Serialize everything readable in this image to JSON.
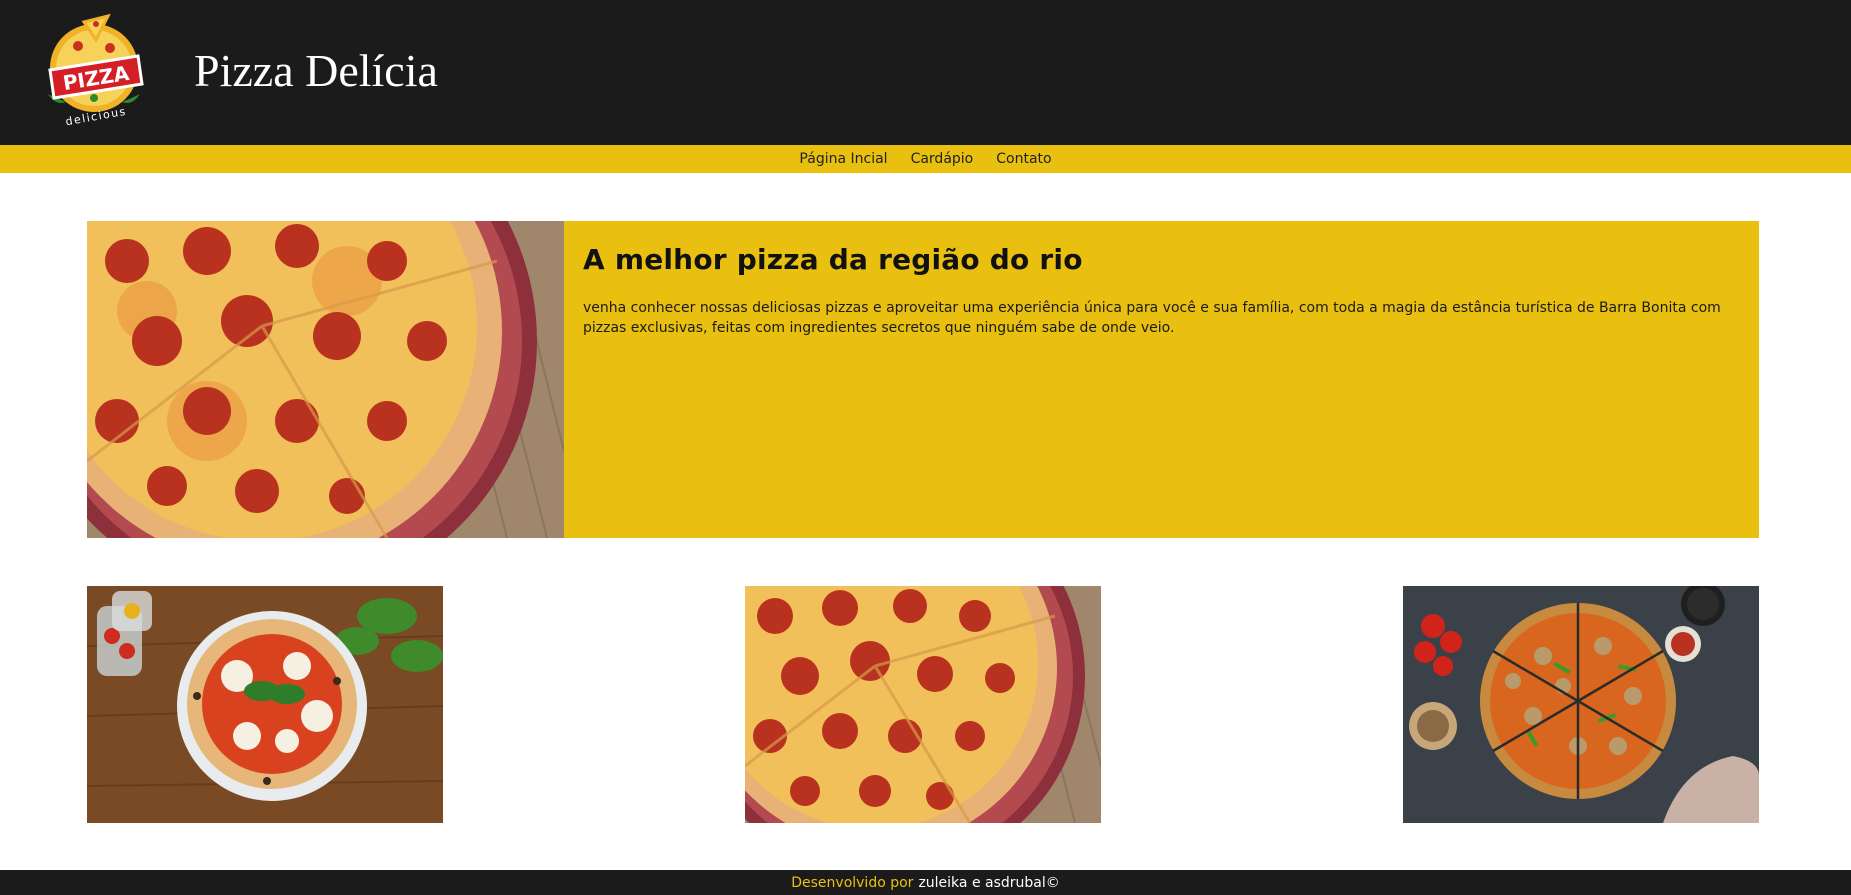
{
  "header": {
    "logo": {
      "icon": "pizza-logo",
      "word": "PIZZA",
      "subword": "delicious"
    },
    "title": "Pizza Delícia"
  },
  "nav": {
    "items": [
      {
        "label": "Página Incial"
      },
      {
        "label": "Cardápio"
      },
      {
        "label": "Contato"
      }
    ]
  },
  "hero": {
    "title": "A melhor pizza da região do rio",
    "text": "venha conhecer nossas deliciosas pizzas e aproveitar uma experiência única para você e sua família, com toda a magia da estância turística de Barra Bonita com pizzas exclusivas, feitas com ingredientes secretos que ninguém sabe de onde veio.",
    "image": "pepperoni-pizza-photo"
  },
  "gallery": [
    {
      "image": "margherita-pizza-photo"
    },
    {
      "image": "pepperoni-pizza-photo"
    },
    {
      "image": "sliced-pizza-top-view-photo"
    }
  ],
  "footer": {
    "label": "Desenvolvido por",
    "authors": "zuleika e asdrubal©"
  },
  "colors": {
    "header_bg": "#1b1b1b",
    "accent": "#e9c00f",
    "footer_bg": "#1b1b1b"
  }
}
